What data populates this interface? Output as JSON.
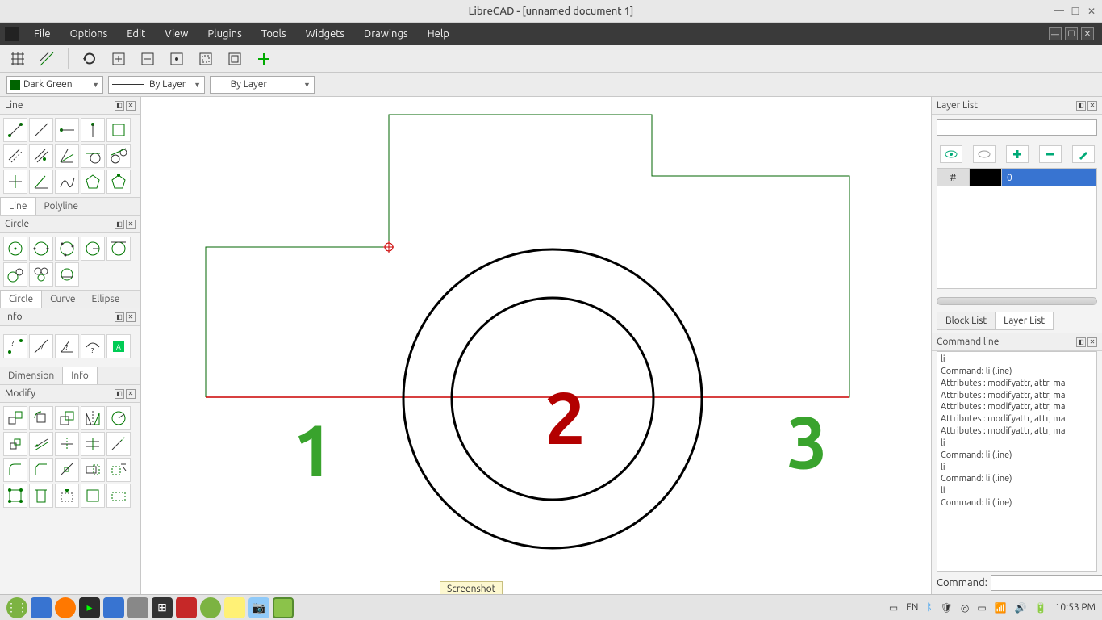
{
  "titlebar": {
    "title": "LibreCAD - [unnamed document 1]"
  },
  "menubar": {
    "items": [
      "File",
      "Edit",
      "View",
      "Plugins",
      "Tools",
      "Widgets",
      "Drawings",
      "Help"
    ]
  },
  "combos": {
    "color_name": "Dark Green",
    "color_hex": "#006400",
    "linetype": "By Layer",
    "lineweight": "By Layer"
  },
  "left_panels": {
    "line": {
      "title": "Line",
      "tabs": [
        "Line",
        "Polyline"
      ],
      "tab_active": "Line"
    },
    "circle": {
      "title": "Circle",
      "tabs": [
        "Circle",
        "Curve",
        "Ellipse"
      ],
      "tab_active": "Circle"
    },
    "info": {
      "title": "Info"
    },
    "dimension": {
      "title": "Dimension",
      "tabs": [
        "Dimension",
        "Info"
      ],
      "tab_active": "Info"
    },
    "modify": {
      "title": "Modify"
    }
  },
  "canvas": {
    "labels": {
      "n1": "1",
      "n2": "2",
      "n3": "3"
    },
    "tooltip": "Screenshot"
  },
  "right": {
    "layer_list": {
      "title": "Layer List",
      "layer0": "0"
    },
    "blocks_tabs": [
      "Block List",
      "Layer List"
    ],
    "blocks_tab_active": "Layer List",
    "cmd": {
      "title": "Command line",
      "lines": [
        "li",
        "Command: li (line)",
        "Attributes : modifyattr, attr, ma",
        "Attributes : modifyattr, attr, ma",
        "Attributes : modifyattr, attr, ma",
        "Attributes : modifyattr, attr, ma",
        "Attributes : modifyattr, attr, ma",
        "li",
        "Command: li (line)",
        "li",
        "Command: li (line)",
        "li",
        "Command: li (line)"
      ],
      "prompt": "Command:"
    }
  },
  "taskbar": {
    "lang": "EN",
    "time": "10:53 PM"
  }
}
